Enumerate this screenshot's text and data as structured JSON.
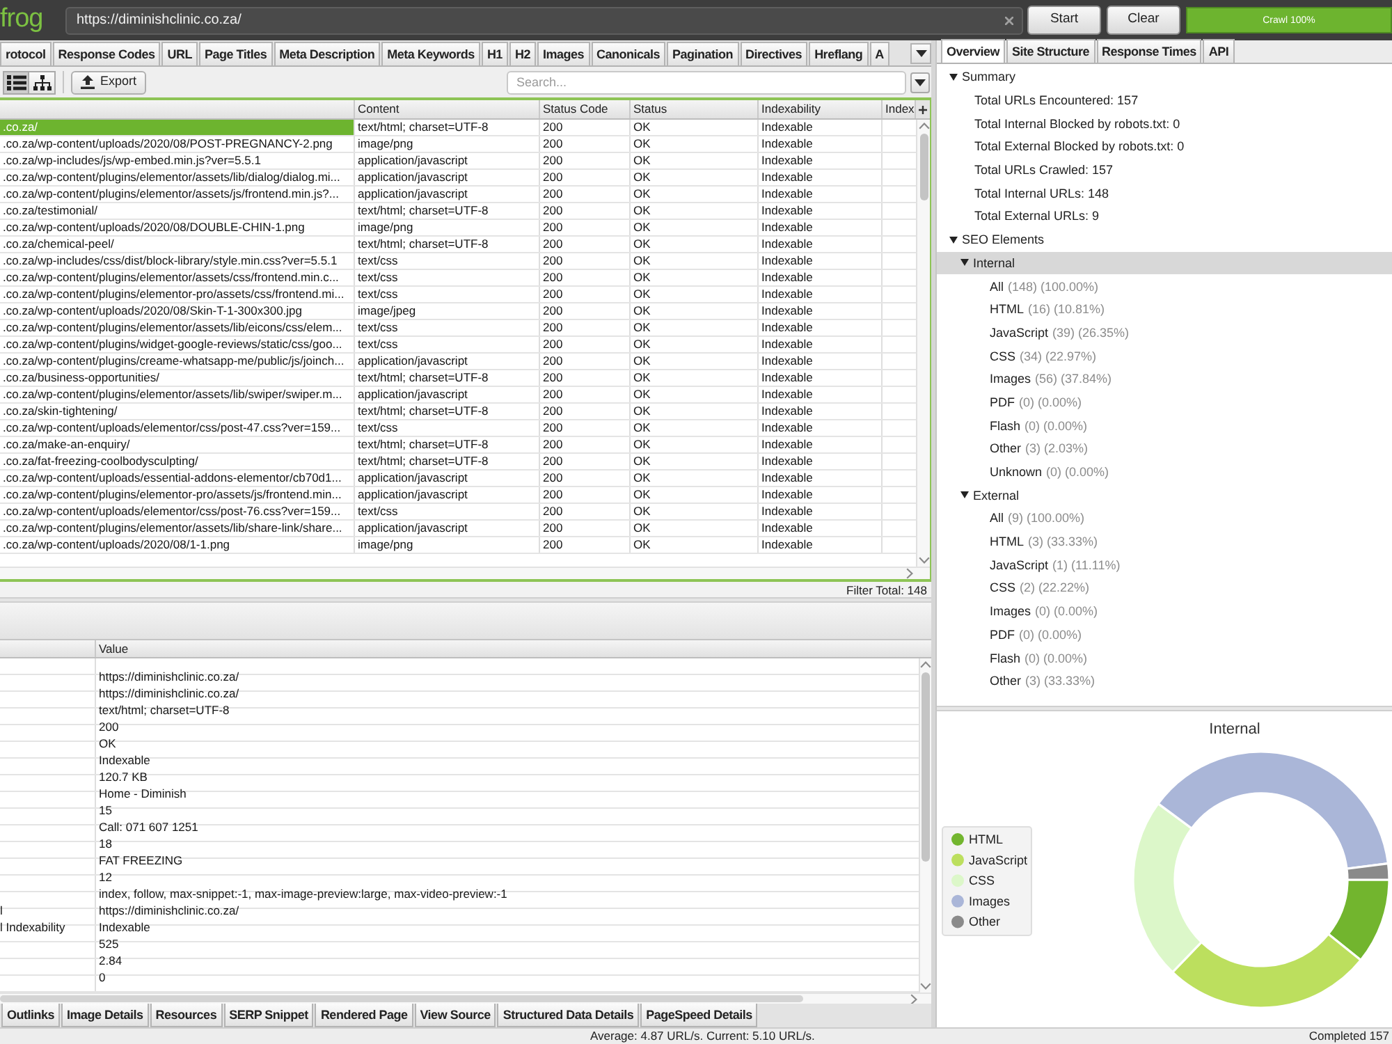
{
  "toolbar": {
    "logo": "frog",
    "url_field": {
      "value": "https://diminishclinic.co.za/"
    },
    "buttons": [
      "Start",
      "Clear"
    ],
    "progress": {
      "label": "Crawl 100%",
      "level": 1
    }
  },
  "main_tabs": [
    {
      "label": "rotocol",
      "selected": false
    },
    {
      "label": "Response Codes",
      "selected": false
    },
    {
      "label": "URL",
      "selected": false
    },
    {
      "label": "Page Titles",
      "selected": false
    },
    {
      "label": "Meta Description",
      "selected": false
    },
    {
      "label": "Meta Keywords",
      "selected": false
    },
    {
      "label": "H1",
      "selected": false
    },
    {
      "label": "H2",
      "selected": false
    },
    {
      "label": "Images",
      "selected": false
    },
    {
      "label": "Canonicals",
      "selected": false
    },
    {
      "label": "Pagination",
      "selected": false
    },
    {
      "label": "Directives",
      "selected": false
    },
    {
      "label": "Hreflang",
      "selected": false
    },
    {
      "label": "A",
      "selected": false
    }
  ],
  "view_toggle": [
    {
      "kind": "list",
      "selected": true
    },
    {
      "kind": "tree",
      "selected": false
    }
  ],
  "export_button": "Export",
  "search": {
    "placeholder": "Search..."
  },
  "table": {
    "columns": [
      "",
      "Content",
      "Status Code",
      "Status",
      "Indexability",
      "Index"
    ],
    "rows": [
      {
        "cells": [
          ".co.za/",
          "text/html; charset=UTF-8",
          "200",
          "OK",
          "Indexable"
        ],
        "selected": true
      },
      {
        "cells": [
          ".co.za/wp-content/uploads/2020/08/POST-PREGNANCY-2.png",
          "image/png",
          "200",
          "OK",
          "Indexable"
        ],
        "selected": false
      },
      {
        "cells": [
          ".co.za/wp-includes/js/wp-embed.min.js?ver=5.5.1",
          "application/javascript",
          "200",
          "OK",
          "Indexable"
        ],
        "selected": false
      },
      {
        "cells": [
          ".co.za/wp-content/plugins/elementor/assets/lib/dialog/dialog.mi...",
          "application/javascript",
          "200",
          "OK",
          "Indexable"
        ],
        "selected": false
      },
      {
        "cells": [
          ".co.za/wp-content/plugins/elementor/assets/js/frontend.min.js?...",
          "application/javascript",
          "200",
          "OK",
          "Indexable"
        ],
        "selected": false
      },
      {
        "cells": [
          ".co.za/testimonial/",
          "text/html; charset=UTF-8",
          "200",
          "OK",
          "Indexable"
        ],
        "selected": false
      },
      {
        "cells": [
          ".co.za/wp-content/uploads/2020/08/DOUBLE-CHIN-1.png",
          "image/png",
          "200",
          "OK",
          "Indexable"
        ],
        "selected": false
      },
      {
        "cells": [
          ".co.za/chemical-peel/",
          "text/html; charset=UTF-8",
          "200",
          "OK",
          "Indexable"
        ],
        "selected": false
      },
      {
        "cells": [
          ".co.za/wp-includes/css/dist/block-library/style.min.css?ver=5.5.1",
          "text/css",
          "200",
          "OK",
          "Indexable"
        ],
        "selected": false
      },
      {
        "cells": [
          ".co.za/wp-content/plugins/elementor/assets/css/frontend.min.c...",
          "text/css",
          "200",
          "OK",
          "Indexable"
        ],
        "selected": false
      },
      {
        "cells": [
          ".co.za/wp-content/plugins/elementor-pro/assets/css/frontend.mi...",
          "text/css",
          "200",
          "OK",
          "Indexable"
        ],
        "selected": false
      },
      {
        "cells": [
          ".co.za/wp-content/uploads/2020/08/Skin-T-1-300x300.jpg",
          "image/jpeg",
          "200",
          "OK",
          "Indexable"
        ],
        "selected": false
      },
      {
        "cells": [
          ".co.za/wp-content/plugins/elementor/assets/lib/eicons/css/elem...",
          "text/css",
          "200",
          "OK",
          "Indexable"
        ],
        "selected": false
      },
      {
        "cells": [
          ".co.za/wp-content/plugins/widget-google-reviews/static/css/goo...",
          "text/css",
          "200",
          "OK",
          "Indexable"
        ],
        "selected": false
      },
      {
        "cells": [
          ".co.za/wp-content/plugins/creame-whatsapp-me/public/js/joinch...",
          "application/javascript",
          "200",
          "OK",
          "Indexable"
        ],
        "selected": false
      },
      {
        "cells": [
          ".co.za/business-opportunities/",
          "text/html; charset=UTF-8",
          "200",
          "OK",
          "Indexable"
        ],
        "selected": false
      },
      {
        "cells": [
          ".co.za/wp-content/plugins/elementor/assets/lib/swiper/swiper.m...",
          "application/javascript",
          "200",
          "OK",
          "Indexable"
        ],
        "selected": false
      },
      {
        "cells": [
          ".co.za/skin-tightening/",
          "text/html; charset=UTF-8",
          "200",
          "OK",
          "Indexable"
        ],
        "selected": false
      },
      {
        "cells": [
          ".co.za/wp-content/uploads/elementor/css/post-47.css?ver=159...",
          "text/css",
          "200",
          "OK",
          "Indexable"
        ],
        "selected": false
      },
      {
        "cells": [
          ".co.za/make-an-enquiry/",
          "text/html; charset=UTF-8",
          "200",
          "OK",
          "Indexable"
        ],
        "selected": false
      },
      {
        "cells": [
          ".co.za/fat-freezing-coolbodysculpting/",
          "text/html; charset=UTF-8",
          "200",
          "OK",
          "Indexable"
        ],
        "selected": false
      },
      {
        "cells": [
          ".co.za/wp-content/uploads/essential-addons-elementor/cb70d1...",
          "application/javascript",
          "200",
          "OK",
          "Indexable"
        ],
        "selected": false
      },
      {
        "cells": [
          ".co.za/wp-content/plugins/elementor-pro/assets/js/frontend.min...",
          "application/javascript",
          "200",
          "OK",
          "Indexable"
        ],
        "selected": false
      },
      {
        "cells": [
          ".co.za/wp-content/uploads/elementor/css/post-76.css?ver=159...",
          "text/css",
          "200",
          "OK",
          "Indexable"
        ],
        "selected": false
      },
      {
        "cells": [
          ".co.za/wp-content/plugins/elementor/assets/lib/share-link/share...",
          "application/javascript",
          "200",
          "OK",
          "Indexable"
        ],
        "selected": false
      },
      {
        "cells": [
          ".co.za/wp-content/uploads/2020/08/1-1.png",
          "image/png",
          "200",
          "OK",
          "Indexable"
        ],
        "selected": false
      }
    ],
    "filter_total": "Filter Total: 148"
  },
  "details": {
    "columns": [
      "",
      "Value"
    ],
    "rows": [
      {
        "cells": [
          "",
          "https://diminishclinic.co.za/"
        ]
      },
      {
        "cells": [
          "",
          "https://diminishclinic.co.za/"
        ]
      },
      {
        "cells": [
          "",
          "text/html; charset=UTF-8"
        ]
      },
      {
        "cells": [
          "",
          "200"
        ]
      },
      {
        "cells": [
          "",
          "OK"
        ]
      },
      {
        "cells": [
          "",
          "Indexable"
        ]
      },
      {
        "cells": [
          "",
          "120.7 KB"
        ]
      },
      {
        "cells": [
          "",
          "Home - Diminish"
        ]
      },
      {
        "cells": [
          "",
          "15"
        ]
      },
      {
        "cells": [
          "",
          "Call: 071 607 1251"
        ]
      },
      {
        "cells": [
          "",
          "18"
        ]
      },
      {
        "cells": [
          "",
          "FAT FREEZING"
        ]
      },
      {
        "cells": [
          "",
          "12"
        ]
      },
      {
        "cells": [
          "",
          "index, follow, max-snippet:-1, max-image-preview:large, max-video-preview:-1"
        ]
      },
      {
        "cells": [
          "l",
          "https://diminishclinic.co.za/"
        ]
      },
      {
        "cells": [
          "l Indexability",
          "Indexable"
        ]
      },
      {
        "cells": [
          "",
          "525"
        ]
      },
      {
        "cells": [
          "",
          "2.84"
        ]
      },
      {
        "cells": [
          "",
          "0"
        ]
      }
    ]
  },
  "detail_tabs": [
    {
      "label": "Outlinks",
      "selected": false
    },
    {
      "label": "Image Details",
      "selected": false
    },
    {
      "label": "Resources",
      "selected": false
    },
    {
      "label": "SERP Snippet",
      "selected": false
    },
    {
      "label": "Rendered Page",
      "selected": false
    },
    {
      "label": "View Source",
      "selected": false
    },
    {
      "label": "Structured Data Details",
      "selected": false
    },
    {
      "label": "PageSpeed Details",
      "selected": false
    }
  ],
  "side_tabs": [
    {
      "label": "Overview",
      "selected": true
    },
    {
      "label": "Site Structure",
      "selected": false
    },
    {
      "label": "Response Times",
      "selected": false
    },
    {
      "label": "API",
      "selected": false
    }
  ],
  "overview_tree": [
    {
      "label": "Summary",
      "expanded": true,
      "selected": false,
      "children": [
        {
          "label": "Total URLs Encountered: 157",
          "selected": false
        },
        {
          "label": "Total Internal Blocked by robots.txt: 0",
          "selected": false
        },
        {
          "label": "Total External Blocked by robots.txt: 0",
          "selected": false
        },
        {
          "label": "Total URLs Crawled: 157",
          "selected": false
        },
        {
          "label": "Total Internal URLs: 148",
          "selected": false
        },
        {
          "label": "Total External URLs: 9",
          "selected": false
        }
      ]
    },
    {
      "label": "SEO Elements",
      "expanded": true,
      "selected": false,
      "children": [
        {
          "label": "Internal",
          "expanded": true,
          "selected": true,
          "children": [
            {
              "label": "All",
              "count": "(148) (100.00%)",
              "selected": false
            },
            {
              "label": "HTML",
              "count": "(16) (10.81%)",
              "selected": false
            },
            {
              "label": "JavaScript",
              "count": "(39) (26.35%)",
              "selected": false
            },
            {
              "label": "CSS",
              "count": "(34) (22.97%)",
              "selected": false
            },
            {
              "label": "Images",
              "count": "(56) (37.84%)",
              "selected": false
            },
            {
              "label": "PDF",
              "count": "(0) (0.00%)",
              "selected": false
            },
            {
              "label": "Flash",
              "count": "(0) (0.00%)",
              "selected": false
            },
            {
              "label": "Other",
              "count": "(3) (2.03%)",
              "selected": false
            },
            {
              "label": "Unknown",
              "count": "(0) (0.00%)",
              "selected": false
            }
          ]
        },
        {
          "label": "External",
          "expanded": true,
          "selected": false,
          "children": [
            {
              "label": "All",
              "count": "(9) (100.00%)",
              "selected": false
            },
            {
              "label": "HTML",
              "count": "(3) (33.33%)",
              "selected": false
            },
            {
              "label": "JavaScript",
              "count": "(1) (11.11%)",
              "selected": false
            },
            {
              "label": "CSS",
              "count": "(2) (22.22%)",
              "selected": false
            },
            {
              "label": "Images",
              "count": "(0) (0.00%)",
              "selected": false
            },
            {
              "label": "PDF",
              "count": "(0) (0.00%)",
              "selected": false
            },
            {
              "label": "Flash",
              "count": "(0) (0.00%)",
              "selected": false
            },
            {
              "label": "Other",
              "count": "(3) (33.33%)",
              "selected": false
            }
          ]
        }
      ]
    }
  ],
  "overview_chart": {
    "chart_data": {
      "type": "donut",
      "title": "Internal",
      "legend": "left",
      "categories": [
        "HTML",
        "JavaScript",
        "CSS",
        "Images",
        "Other"
      ],
      "series": [
        {
          "values": [
            10.81,
            26.35,
            22.97,
            37.84,
            2.03
          ]
        }
      ]
    },
    "slices": [
      {
        "color": "#72b52e"
      },
      {
        "color": "#bcdf5e"
      },
      {
        "color": "#dcf7c9"
      },
      {
        "color": "#aab6d8"
      },
      {
        "color": "#8a8a8a"
      }
    ]
  },
  "status_bar": {
    "speed": "Average: 4.87 URL/s. Current: 5.10 URL/s.",
    "completed": "Completed 157"
  }
}
